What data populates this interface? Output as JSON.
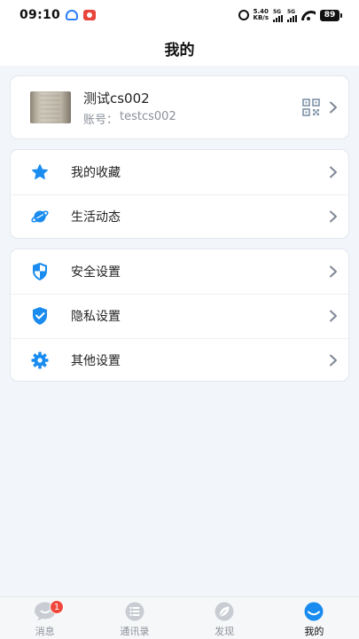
{
  "status_bar": {
    "time": "09:10",
    "net_speed_value": "5.40",
    "net_speed_unit": "KB/s",
    "signal1_label": "5G",
    "signal2_label": "5G",
    "battery": "89"
  },
  "header": {
    "title": "我的"
  },
  "profile": {
    "name": "测试cs002",
    "account_label": "账号：",
    "account_value": "testcs002"
  },
  "menu_group_1": [
    {
      "label": "我的收藏",
      "icon": "star-icon"
    },
    {
      "label": "生活动态",
      "icon": "planet-icon"
    }
  ],
  "menu_group_2": [
    {
      "label": "安全设置",
      "icon": "shield-icon"
    },
    {
      "label": "隐私设置",
      "icon": "shield-check-icon"
    },
    {
      "label": "其他设置",
      "icon": "gear-icon"
    }
  ],
  "bottom_nav": [
    {
      "label": "消息",
      "icon": "chat-icon",
      "badge": "1",
      "active": false
    },
    {
      "label": "通讯录",
      "icon": "contacts-icon",
      "active": false
    },
    {
      "label": "发现",
      "icon": "compass-icon",
      "active": false
    },
    {
      "label": "我的",
      "icon": "profile-icon",
      "active": true
    }
  ],
  "colors": {
    "accent": "#1a8cf0",
    "inactive_icon": "#c9cdd3",
    "background": "#f2f5f9",
    "badge": "#f0473c"
  }
}
